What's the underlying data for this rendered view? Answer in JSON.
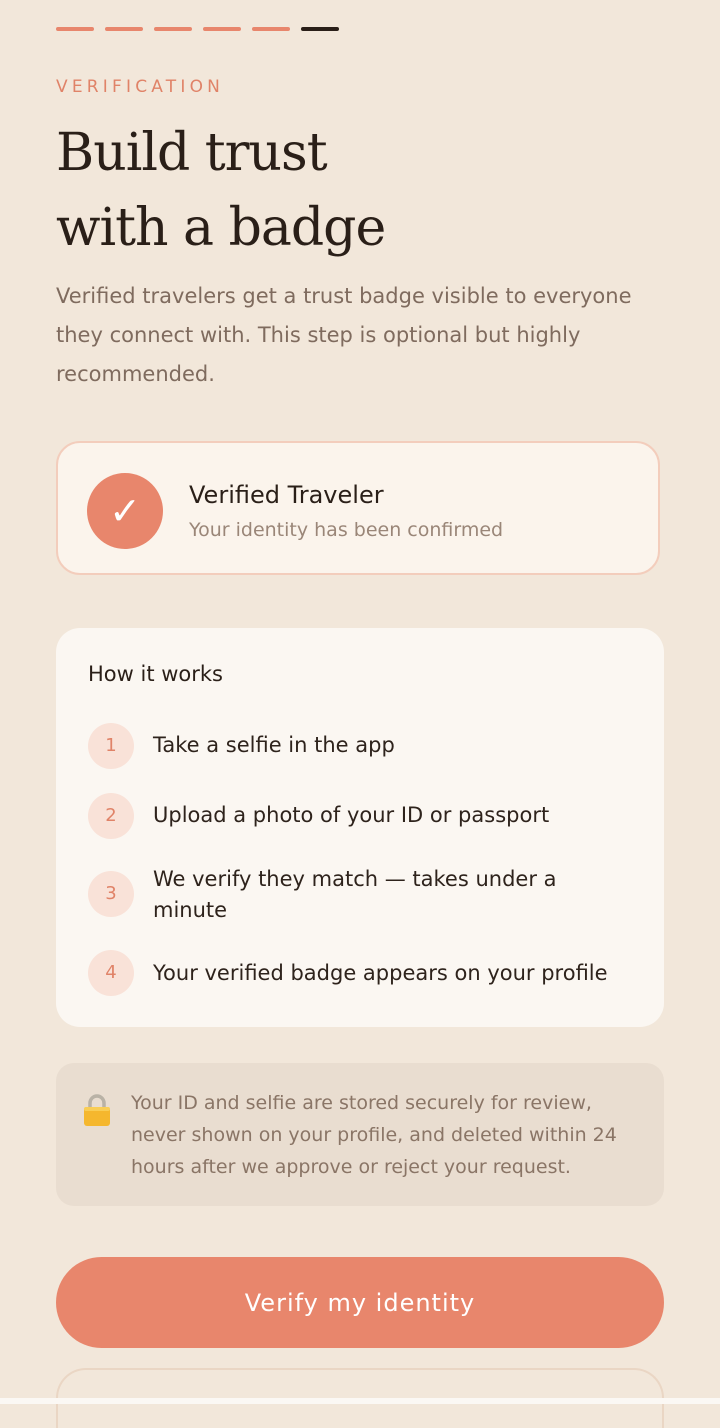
{
  "progress": {
    "total_steps": 6,
    "current_step": 6
  },
  "eyebrow": "VERIFICATION",
  "title": {
    "line1": "Build trust",
    "line2": "with a badge"
  },
  "lede": "Verified travelers get a trust badge visible to everyone they connect with. This step is optional but highly recommended.",
  "badge_preview": {
    "check_glyph": "✓",
    "title": "Verified Traveler",
    "subtitle": "Your identity has been confirmed"
  },
  "how_it_works": {
    "heading": "How it works",
    "steps": [
      {
        "number": "1",
        "text": "Take a selfie in the app"
      },
      {
        "number": "2",
        "text": "Upload a photo of your ID or passport"
      },
      {
        "number": "3",
        "text": "We verify they match — takes under a minute"
      },
      {
        "number": "4",
        "text": "Your verified badge appears on your profile"
      }
    ]
  },
  "privacy": {
    "icon": "lock-icon",
    "text": "Your ID and selfie are stored securely for review, never shown on your profile, and deleted within 24 hours after we approve or reject your request."
  },
  "cta": {
    "label": "Verify my identity"
  },
  "colors": {
    "accent": "#e8866c",
    "background": "#f2e7da",
    "text": "#2a1f18"
  }
}
